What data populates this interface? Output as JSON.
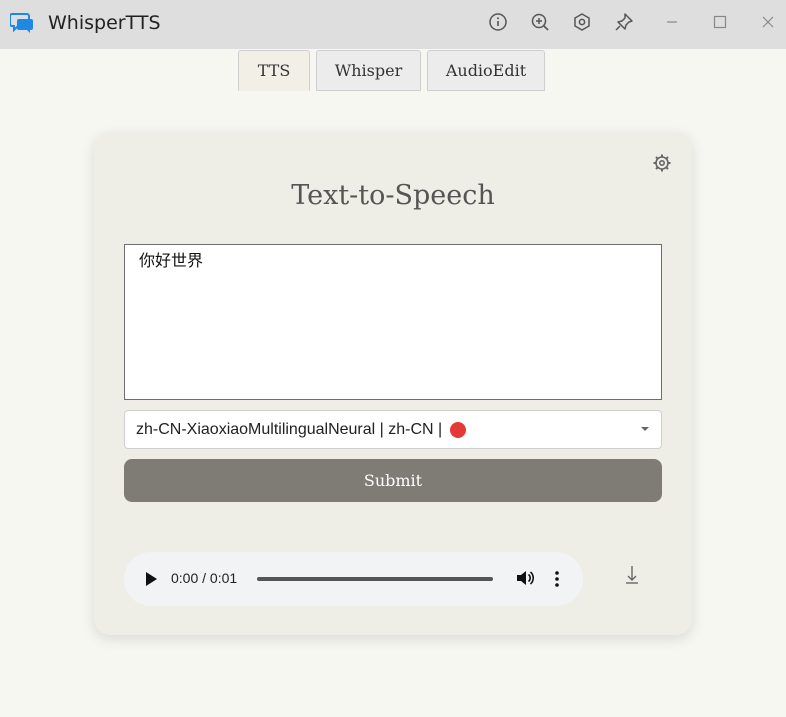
{
  "window": {
    "title": "WhisperTTS",
    "toolbar_icons": [
      "info-icon",
      "zoom-in-icon",
      "settings-hex-icon",
      "pin-icon",
      "minimize-icon",
      "maximize-icon",
      "close-icon"
    ]
  },
  "tabs": [
    {
      "label": "TTS",
      "active": true
    },
    {
      "label": "Whisper",
      "active": false
    },
    {
      "label": "AudioEdit",
      "active": false
    }
  ],
  "card": {
    "title": "Text-to-Speech",
    "text_input_value": "你好世界",
    "voice_select": {
      "value": "zh-CN-XiaoxiaoMultilingualNeural | zh-CN |",
      "indicator_color": "#e53935"
    },
    "submit_label": "Submit",
    "audio": {
      "time": "0:00 / 0:01"
    }
  },
  "colors": {
    "accent_button": "#7f7c75",
    "card_bg": "#efeee6",
    "page_bg": "#f7f7f2"
  }
}
